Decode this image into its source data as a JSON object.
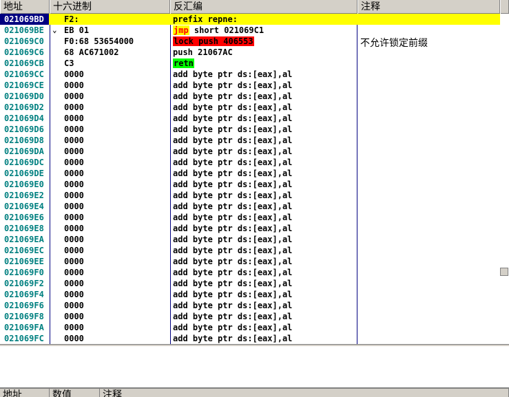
{
  "columns": {
    "address": "地址",
    "hex": "十六进制",
    "disasm": "反汇编",
    "comment": "注释"
  },
  "dump_columns": {
    "address": "地址",
    "value": "数值",
    "comment": "注释"
  },
  "comment_text": "不允许锁定前缀",
  "colors": {
    "selected_row": "#ffff00",
    "selected_address": "#000080",
    "address_text": "#008080",
    "highlight_red": "#ff0000",
    "highlight_green": "#00ff00",
    "jump_text": "#ff0000"
  },
  "rows": [
    {
      "addr": "021069BD",
      "arrow": "",
      "hex": "F2:",
      "parts": [
        {
          "t": "prefix repne:",
          "s": ""
        }
      ],
      "selected": true
    },
    {
      "addr": "021069BE",
      "arrow": "⌄",
      "hex": "EB 01",
      "parts": [
        {
          "t": "jmp",
          "s": "jmp"
        },
        {
          "t": " short 021069C1",
          "s": ""
        }
      ]
    },
    {
      "addr": "021069C0",
      "arrow": "",
      "hex": "F0:68 53654000",
      "parts": [
        {
          "t": "lock push 406553",
          "s": "red"
        }
      ]
    },
    {
      "addr": "021069C6",
      "arrow": "",
      "hex": "68 AC671002",
      "parts": [
        {
          "t": "push 21067AC",
          "s": ""
        }
      ]
    },
    {
      "addr": "021069CB",
      "arrow": "",
      "hex": "C3",
      "parts": [
        {
          "t": "retn",
          "s": "green"
        }
      ]
    },
    {
      "addr": "021069CC",
      "arrow": "",
      "hex": "0000",
      "parts": [
        {
          "t": "add byte ptr ds:[eax],al",
          "s": ""
        }
      ]
    },
    {
      "addr": "021069CE",
      "arrow": "",
      "hex": "0000",
      "parts": [
        {
          "t": "add byte ptr ds:[eax],al",
          "s": ""
        }
      ]
    },
    {
      "addr": "021069D0",
      "arrow": "",
      "hex": "0000",
      "parts": [
        {
          "t": "add byte ptr ds:[eax],al",
          "s": ""
        }
      ]
    },
    {
      "addr": "021069D2",
      "arrow": "",
      "hex": "0000",
      "parts": [
        {
          "t": "add byte ptr ds:[eax],al",
          "s": ""
        }
      ]
    },
    {
      "addr": "021069D4",
      "arrow": "",
      "hex": "0000",
      "parts": [
        {
          "t": "add byte ptr ds:[eax],al",
          "s": ""
        }
      ]
    },
    {
      "addr": "021069D6",
      "arrow": "",
      "hex": "0000",
      "parts": [
        {
          "t": "add byte ptr ds:[eax],al",
          "s": ""
        }
      ]
    },
    {
      "addr": "021069D8",
      "arrow": "",
      "hex": "0000",
      "parts": [
        {
          "t": "add byte ptr ds:[eax],al",
          "s": ""
        }
      ]
    },
    {
      "addr": "021069DA",
      "arrow": "",
      "hex": "0000",
      "parts": [
        {
          "t": "add byte ptr ds:[eax],al",
          "s": ""
        }
      ]
    },
    {
      "addr": "021069DC",
      "arrow": "",
      "hex": "0000",
      "parts": [
        {
          "t": "add byte ptr ds:[eax],al",
          "s": ""
        }
      ]
    },
    {
      "addr": "021069DE",
      "arrow": "",
      "hex": "0000",
      "parts": [
        {
          "t": "add byte ptr ds:[eax],al",
          "s": ""
        }
      ]
    },
    {
      "addr": "021069E0",
      "arrow": "",
      "hex": "0000",
      "parts": [
        {
          "t": "add byte ptr ds:[eax],al",
          "s": ""
        }
      ]
    },
    {
      "addr": "021069E2",
      "arrow": "",
      "hex": "0000",
      "parts": [
        {
          "t": "add byte ptr ds:[eax],al",
          "s": ""
        }
      ]
    },
    {
      "addr": "021069E4",
      "arrow": "",
      "hex": "0000",
      "parts": [
        {
          "t": "add byte ptr ds:[eax],al",
          "s": ""
        }
      ]
    },
    {
      "addr": "021069E6",
      "arrow": "",
      "hex": "0000",
      "parts": [
        {
          "t": "add byte ptr ds:[eax],al",
          "s": ""
        }
      ]
    },
    {
      "addr": "021069E8",
      "arrow": "",
      "hex": "0000",
      "parts": [
        {
          "t": "add byte ptr ds:[eax],al",
          "s": ""
        }
      ]
    },
    {
      "addr": "021069EA",
      "arrow": "",
      "hex": "0000",
      "parts": [
        {
          "t": "add byte ptr ds:[eax],al",
          "s": ""
        }
      ]
    },
    {
      "addr": "021069EC",
      "arrow": "",
      "hex": "0000",
      "parts": [
        {
          "t": "add byte ptr ds:[eax],al",
          "s": ""
        }
      ]
    },
    {
      "addr": "021069EE",
      "arrow": "",
      "hex": "0000",
      "parts": [
        {
          "t": "add byte ptr ds:[eax],al",
          "s": ""
        }
      ]
    },
    {
      "addr": "021069F0",
      "arrow": "",
      "hex": "0000",
      "parts": [
        {
          "t": "add byte ptr ds:[eax],al",
          "s": ""
        }
      ]
    },
    {
      "addr": "021069F2",
      "arrow": "",
      "hex": "0000",
      "parts": [
        {
          "t": "add byte ptr ds:[eax],al",
          "s": ""
        }
      ]
    },
    {
      "addr": "021069F4",
      "arrow": "",
      "hex": "0000",
      "parts": [
        {
          "t": "add byte ptr ds:[eax],al",
          "s": ""
        }
      ]
    },
    {
      "addr": "021069F6",
      "arrow": "",
      "hex": "0000",
      "parts": [
        {
          "t": "add byte ptr ds:[eax],al",
          "s": ""
        }
      ]
    },
    {
      "addr": "021069F8",
      "arrow": "",
      "hex": "0000",
      "parts": [
        {
          "t": "add byte ptr ds:[eax],al",
          "s": ""
        }
      ]
    },
    {
      "addr": "021069FA",
      "arrow": "",
      "hex": "0000",
      "parts": [
        {
          "t": "add byte ptr ds:[eax],al",
          "s": ""
        }
      ]
    },
    {
      "addr": "021069FC",
      "arrow": "",
      "hex": "0000",
      "parts": [
        {
          "t": "add byte ptr ds:[eax],al",
          "s": ""
        }
      ]
    }
  ]
}
